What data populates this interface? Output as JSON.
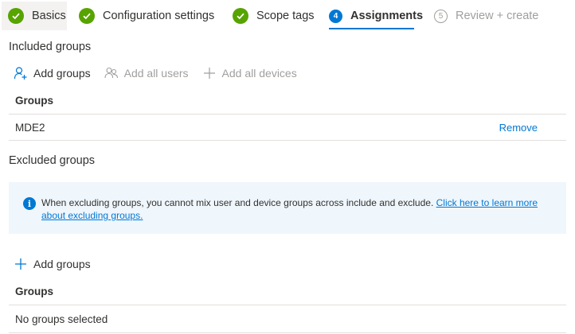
{
  "wizard": {
    "steps": [
      {
        "label": "Basics",
        "state": "completed"
      },
      {
        "label": "Configuration settings",
        "state": "completed"
      },
      {
        "label": "Scope tags",
        "state": "completed"
      },
      {
        "label": "Assignments",
        "state": "current",
        "number": "4"
      },
      {
        "label": "Review + create",
        "state": "disabled",
        "number": "5"
      }
    ]
  },
  "included": {
    "title": "Included groups",
    "commands": {
      "add_groups": "Add groups",
      "add_all_users": "Add all users",
      "add_all_devices": "Add all devices"
    },
    "table": {
      "header": "Groups",
      "rows": [
        {
          "name": "MDE2",
          "action": "Remove"
        }
      ]
    }
  },
  "excluded": {
    "title": "Excluded groups",
    "banner": {
      "text": "When excluding groups, you cannot mix user and device groups across include and exclude. ",
      "link": "Click here to learn more about excluding groups."
    },
    "commands": {
      "add_groups": "Add groups"
    },
    "table": {
      "header": "Groups",
      "empty_text": "No groups selected"
    }
  },
  "colors": {
    "accent": "#0078d4",
    "success": "#57a300",
    "disabled": "#a19f9d",
    "banner_bg": "#eff6fc"
  }
}
